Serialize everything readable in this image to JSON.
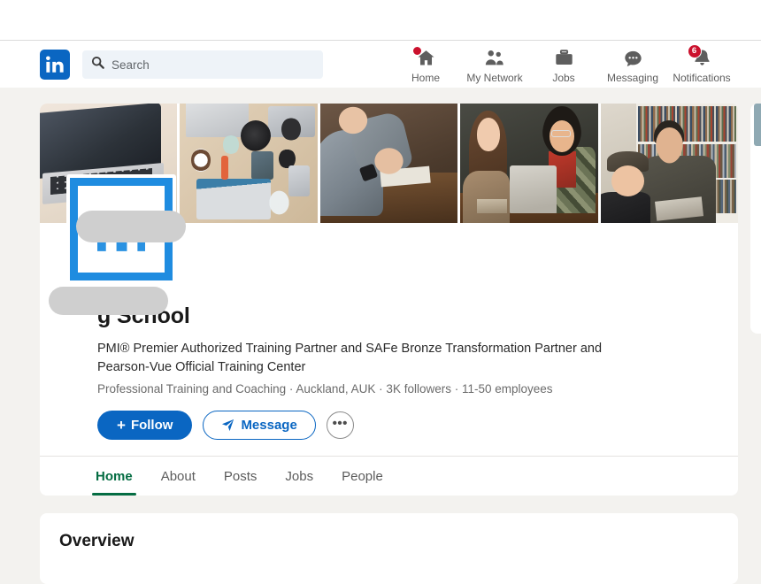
{
  "topnav": {
    "logo_icon": "linkedin-logo-icon",
    "search": {
      "icon": "search-icon",
      "placeholder": "Search",
      "value": ""
    },
    "items": [
      {
        "label": "Home",
        "icon": "home-icon",
        "badge": "",
        "badge_type": "dot"
      },
      {
        "label": "My Network",
        "icon": "people-icon",
        "badge": "",
        "badge_type": "none"
      },
      {
        "label": "Jobs",
        "icon": "briefcase-icon",
        "badge": "",
        "badge_type": "none"
      },
      {
        "label": "Messaging",
        "icon": "message-bubble-icon",
        "badge": "",
        "badge_type": "none"
      },
      {
        "label": "Notifications",
        "icon": "bell-icon",
        "badge": "6",
        "badge_type": "number"
      }
    ]
  },
  "profile": {
    "banner_alt": "company-banner-photo-collage",
    "logo_alt": "company-logo",
    "company_name": "g School",
    "tagline": "PMI® Premier Authorized Training Partner and SAFe Bronze Transformation Partner and Pearson-Vue Official Training Center",
    "meta": "Professional Training and Coaching · Auckland, AUK · 3K followers · 11-50 employees",
    "actions": {
      "follow_plus": "+",
      "follow_label": "Follow",
      "message_icon": "send-icon",
      "message_label": "Message",
      "more_label": "•••"
    },
    "tabs": [
      {
        "label": "Home",
        "active": true
      },
      {
        "label": "About",
        "active": false
      },
      {
        "label": "Posts",
        "active": false
      },
      {
        "label": "Jobs",
        "active": false
      },
      {
        "label": "People",
        "active": false
      }
    ]
  },
  "overview": {
    "title": "Overview"
  },
  "colors": {
    "linkedin_blue": "#0a66c2",
    "logo_blue": "#1f8ce0",
    "active_tab_green": "#056d43",
    "badge_red": "#cb112d",
    "page_bg": "#f3f2ef",
    "redaction_gray": "#cfcfcf"
  }
}
